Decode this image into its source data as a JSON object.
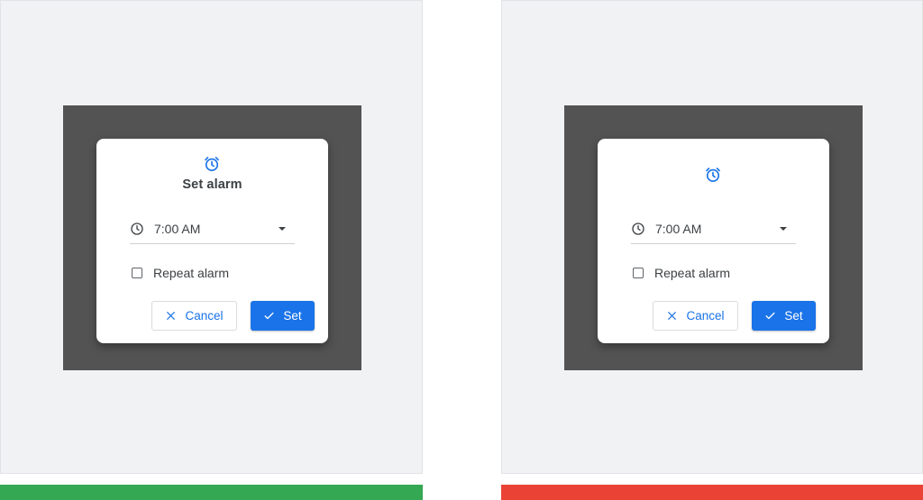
{
  "examples": [
    {
      "dialog": {
        "icon": "alarm-clock-icon",
        "title": "Set alarm",
        "time_icon": "clock-icon",
        "time_value": "7:00 AM",
        "dropdown_icon": "dropdown-arrow-icon",
        "repeat_checked": false,
        "repeat_label": "Repeat alarm",
        "cancel_icon": "close-icon",
        "cancel_label": "Cancel",
        "set_icon": "check-icon",
        "set_label": "Set"
      },
      "indicator_color": "#34a853"
    },
    {
      "dialog": {
        "icon": "alarm-clock-icon",
        "time_icon": "clock-icon",
        "time_value": "7:00 AM",
        "dropdown_icon": "dropdown-arrow-icon",
        "repeat_checked": false,
        "repeat_label": "Repeat alarm",
        "cancel_icon": "close-icon",
        "cancel_label": "Cancel",
        "set_icon": "check-icon",
        "set_label": "Set"
      },
      "indicator_color": "#ea4335"
    }
  ],
  "colors": {
    "primary": "#1a73e8",
    "scrim": "#535353",
    "background": "#f1f2f4",
    "text": "#3c4043"
  }
}
